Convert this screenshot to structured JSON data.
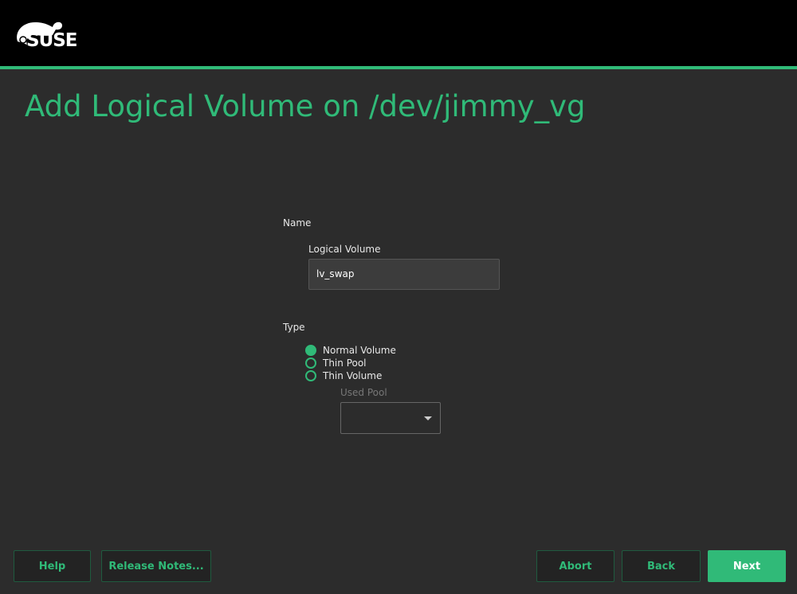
{
  "header": {
    "logo_text": "SUSE",
    "accent": "#30ba78"
  },
  "title": "Add Logical Volume on /dev/jimmy_vg",
  "name_section": {
    "label": "Name",
    "field_label": "Logical Volume",
    "field_value": "lv_swap"
  },
  "type_section": {
    "label": "Type",
    "options": [
      {
        "label": "Normal Volume",
        "selected": true
      },
      {
        "label": "Thin Pool",
        "selected": false
      },
      {
        "label": "Thin Volume",
        "selected": false
      }
    ],
    "used_pool_label": "Used Pool",
    "used_pool_value": ""
  },
  "buttons": {
    "help": "Help",
    "release_notes": "Release Notes...",
    "abort": "Abort",
    "back": "Back",
    "next": "Next"
  }
}
